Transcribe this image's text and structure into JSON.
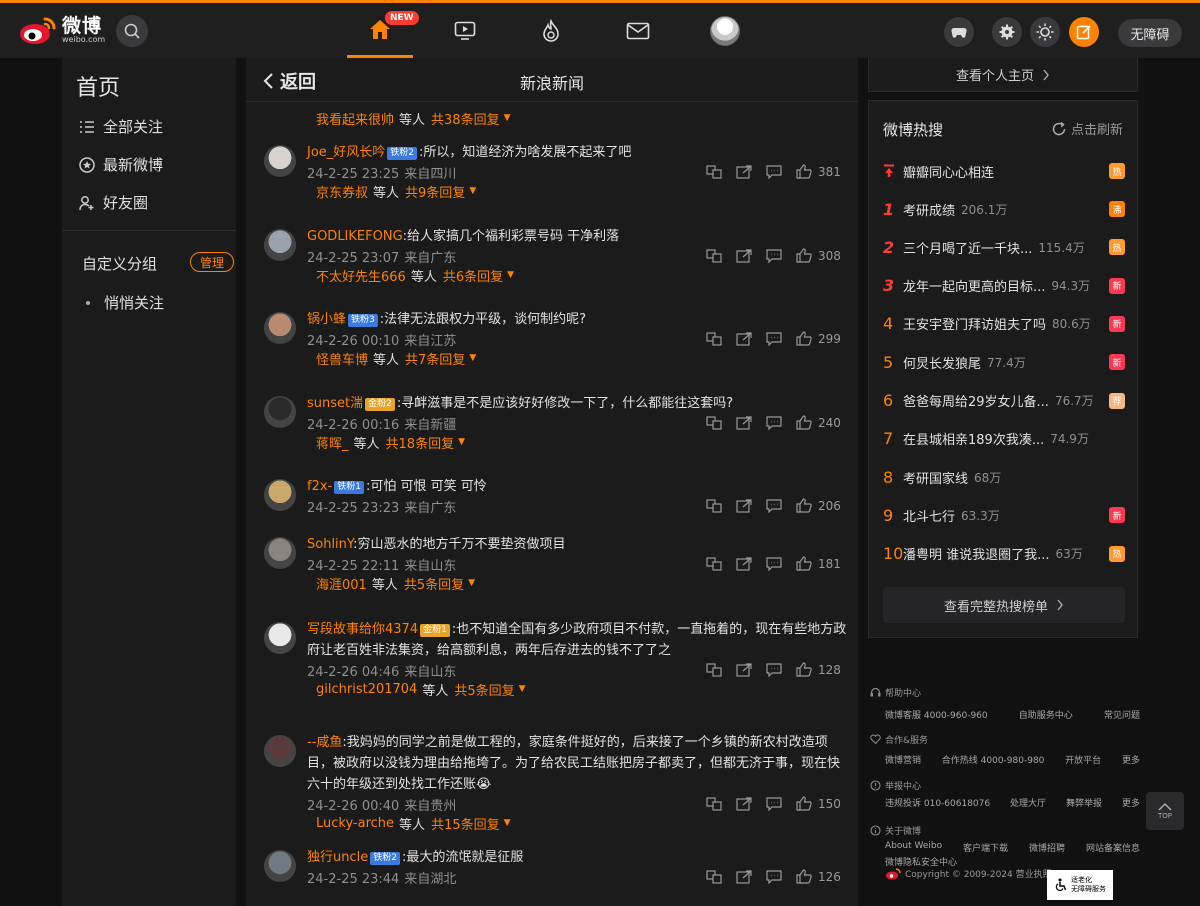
{
  "brand": {
    "name": "微博",
    "sub": "weibo.com"
  },
  "nav": {
    "new_badge": "NEW",
    "accessible": "无障碍"
  },
  "left": {
    "title": "首页",
    "items": [
      {
        "label": "全部关注"
      },
      {
        "label": "最新微博"
      },
      {
        "label": "好友圈"
      }
    ],
    "group_title": "自定义分组",
    "manage": "管理",
    "sub_item": "悄悄关注"
  },
  "main": {
    "back": "返回",
    "title": "新浪新闻",
    "top_reply": {
      "user": "我看起来很帅",
      "mid": "等人",
      "count": "共38条回复"
    },
    "comments": [
      {
        "user": "Joe_好风长吟",
        "badge": "铁粉2",
        "text": ":所以，知道经济为啥发展不起来了吧",
        "time": "24-2-25 23:25",
        "loc": "来自四川",
        "likes": "381",
        "reply_user": "京东券叔",
        "reply_mid": "等人",
        "reply_count": "共9条回复"
      },
      {
        "user": "GODLIKEFONG",
        "badge": "",
        "text": ":给人家搞几个福利彩票号码 干净利落",
        "time": "24-2-25 23:07",
        "loc": "来自广东",
        "likes": "308",
        "reply_user": "不太好先生666",
        "reply_mid": "等人",
        "reply_count": "共6条回复"
      },
      {
        "user": "锅小蜂",
        "badge": "铁粉3",
        "text": ":法律无法跟权力平级，谈何制约呢?",
        "time": "24-2-26 00:10",
        "loc": "来自江苏",
        "likes": "299",
        "reply_user": "怪兽车博",
        "reply_mid": "等人",
        "reply_count": "共7条回复"
      },
      {
        "user": "sunset湍",
        "badge": "金粉2",
        "text": ":寻衅滋事是不是应该好好修改一下了，什么都能往这套吗?",
        "time": "24-2-26 00:16",
        "loc": "来自新疆",
        "likes": "240",
        "reply_user": "蒋晖_",
        "reply_mid": "等人",
        "reply_count": "共18条回复"
      },
      {
        "user": "f2x-",
        "badge": "铁粉1",
        "text": ":可怕 可恨 可笑 可怜",
        "time": "24-2-25 23:23",
        "loc": "来自广东",
        "likes": "206",
        "reply_user": "",
        "reply_mid": "",
        "reply_count": ""
      },
      {
        "user": "SohlinY",
        "badge": "",
        "text": ":穷山恶水的地方千万不要垫资做项目",
        "time": "24-2-25 22:11",
        "loc": "来自山东",
        "likes": "181",
        "reply_user": "海涯001",
        "reply_mid": "等人",
        "reply_count": "共5条回复"
      },
      {
        "user": "写段故事给你4374",
        "badge": "金粉1",
        "text": ":也不知道全国有多少政府项目不付款，一直拖着的，现在有些地方政府让老百姓非法集资，给高额利息，两年后存进去的钱不了了之",
        "time": "24-2-26 04:46",
        "loc": "来自山东",
        "likes": "128",
        "reply_user": "gilchrist201704",
        "reply_mid": "等人",
        "reply_count": "共5条回复"
      },
      {
        "user": "--咸鱼",
        "badge": "",
        "text": ":我妈妈的同学之前是做工程的，家庭条件挺好的，后来接了一个乡镇的新农村改造项目，被政府以没钱为理由给拖垮了。为了给农民工结账把房子都卖了，但都无济于事，现在快六十的年级还到处找工作还账😭",
        "time": "24-2-26 00:40",
        "loc": "来自贵州",
        "likes": "150",
        "reply_user": "Lucky-arche",
        "reply_mid": "等人",
        "reply_count": "共15条回复"
      },
      {
        "user": "独行uncle",
        "badge": "铁粉2",
        "text": ":最大的流氓就是征服",
        "time": "24-2-25 23:44",
        "loc": "来自湖北",
        "likes": "126",
        "reply_user": "",
        "reply_mid": "",
        "reply_count": ""
      }
    ]
  },
  "right": {
    "profile_link": "查看个人主页",
    "hot_title": "微博热搜",
    "refresh": "点击刷新",
    "pinned": "瓣瓣同心心相连",
    "hot": [
      {
        "rank": "1",
        "text": "考研成绩",
        "num": "206.1万",
        "badge": "沸",
        "color": "#ff8200"
      },
      {
        "rank": "2",
        "text": "三个月喝了近一千块...",
        "num": "115.4万",
        "badge": "热",
        "color": "#ff9a2e"
      },
      {
        "rank": "3",
        "text": "龙年一起向更高的目标...",
        "num": "94.3万",
        "badge": "新",
        "color": "#ff3852"
      },
      {
        "rank": "4",
        "text": "王安宇登门拜访姐夫了吗",
        "num": "80.6万",
        "badge": "新",
        "color": "#ff3852"
      },
      {
        "rank": "5",
        "text": "何炅长发狼尾",
        "num": "77.4万",
        "badge": "新",
        "color": "#ff3852"
      },
      {
        "rank": "6",
        "text": "爸爸每周给29岁女儿备...",
        "num": "76.7万",
        "badge": "荐",
        "color": "#f5b885"
      },
      {
        "rank": "7",
        "text": "在县城相亲189次我凑...",
        "num": "74.9万",
        "badge": "",
        "color": ""
      },
      {
        "rank": "8",
        "text": "考研国家线",
        "num": "68万",
        "badge": "",
        "color": ""
      },
      {
        "rank": "9",
        "text": "北斗七行",
        "num": "63.3万",
        "badge": "新",
        "color": "#ff3852"
      },
      {
        "rank": "10",
        "text": "潘粤明 谁说我退圈了我...",
        "num": "63万",
        "badge": "热",
        "color": "#ff9a2e"
      }
    ],
    "full_list": "查看完整热搜榜单"
  },
  "footer": {
    "help": "帮助中心",
    "help_row": [
      "微博客服 4000-960-960",
      "自助服务中心",
      "常见问题"
    ],
    "coop": "合作&服务",
    "coop_row": [
      "微博营销",
      "合作热线 4000-980-980",
      "开放平台",
      "更多"
    ],
    "report": "举报中心",
    "report_row": [
      "违规投诉 010-60618076",
      "处理大厅",
      "舞弊举报",
      "更多"
    ],
    "about": "关于微博",
    "about_row": [
      "About Weibo",
      "客户端下载",
      "微博招聘",
      "网站备案信息"
    ],
    "about_row2": "微博隐私安全中心",
    "copyright": "Copyright © 2009-2024 营业执照",
    "a11y1": "适老化",
    "a11y2": "无障碍服务",
    "top": "TOP"
  }
}
